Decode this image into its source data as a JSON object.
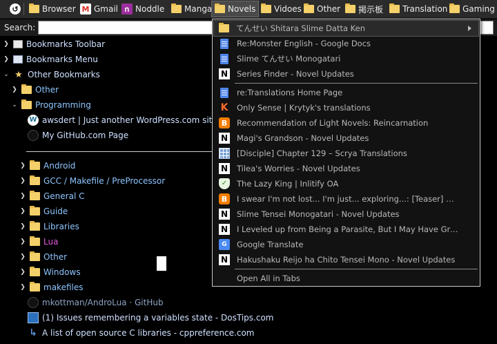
{
  "toolbar": {
    "items": [
      {
        "label": "",
        "icon": "back-icon"
      },
      {
        "label": "Browser",
        "icon": "folder-icon"
      },
      {
        "label": "Gmail",
        "icon": "gmail-icon"
      },
      {
        "label": "Noddle",
        "icon": "noddle-icon"
      },
      {
        "label": "Manga",
        "icon": "folder-icon"
      },
      {
        "label": "Novels",
        "icon": "folder-icon",
        "active": true
      },
      {
        "label": "Vidoes",
        "icon": "folder-icon"
      },
      {
        "label": "Other",
        "icon": "folder-icon"
      },
      {
        "label": "掲示板",
        "icon": "folder-icon"
      },
      {
        "label": "Translation",
        "icon": "folder-icon"
      },
      {
        "label": "Gaming",
        "icon": "folder-icon"
      }
    ]
  },
  "search": {
    "label": "Search:",
    "value": ""
  },
  "tree": {
    "roots": [
      {
        "label": "Bookmarks Toolbar",
        "expanded": false
      },
      {
        "label": "Bookmarks Menu",
        "expanded": false
      },
      {
        "label": "Other Bookmarks",
        "expanded": true
      }
    ],
    "other_folder": "Other",
    "programming_folder": "Programming",
    "programming_links": [
      "awsdert | Just another WordPress.com site",
      "My GitHub.com Page"
    ],
    "subfolders": [
      "Android",
      "GCC / Makefile / PreProcessor",
      "General C",
      "Guide",
      "Libraries",
      "Lua",
      "Other",
      "Windows",
      "makefiles"
    ],
    "bottom_links": [
      "mkottman/AndroLua · GitHub",
      "(1) Issues remembering a variables state - DosTips.com",
      "A list of open source C libraries - cppreference.com"
    ]
  },
  "menu": {
    "items": [
      {
        "label": "てんせい Shitara Slime Datta Ken",
        "icon": "folder-icon",
        "submenu": true
      },
      {
        "label": "Re:Monster English - Google Docs",
        "icon": "google-docs-icon"
      },
      {
        "label": "Slime てんせい Monogatari",
        "icon": "google-docs-icon"
      },
      {
        "label": "Series Finder - Novel Updates",
        "icon": "novel-updates-icon"
      },
      {
        "label": "re:Translations Home Page",
        "icon": "google-docs-icon"
      },
      {
        "label": "Only Sense | Krytyk's translations",
        "icon": "krytyk-icon"
      },
      {
        "label": "Recommendation of Light Novels: Reincarnation",
        "icon": "blogger-icon"
      },
      {
        "label": "Magi's Grandson - Novel Updates",
        "icon": "novel-updates-icon"
      },
      {
        "label": "[Disciple] Chapter 129 – Scrya Translations",
        "icon": "grid-icon"
      },
      {
        "label": "Tilea's Worries - Novel Updates",
        "icon": "novel-updates-icon"
      },
      {
        "label": "The Lazy King | Inlitify OA",
        "icon": "shield-icon"
      },
      {
        "label": "I swear I'm not lost... I'm just... exploring...: [Teaser] 私、能力...",
        "icon": "blogger-icon"
      },
      {
        "label": "Slime Tensei Monogatari - Novel Updates",
        "icon": "novel-updates-icon"
      },
      {
        "label": "I Leveled up from Being a Parasite, But I May Have Grown T...",
        "icon": "novel-updates-icon"
      },
      {
        "label": "Google Translate",
        "icon": "google-translate-icon"
      },
      {
        "label": "Hakushaku Reijo ha Chito Tensei Mono - Novel Updates",
        "icon": "novel-updates-icon"
      }
    ],
    "open_all": "Open All in Tabs"
  },
  "colors": {
    "folder": "#f4d06a",
    "link": "#cfe0ff",
    "folder_text": "#8ec5ff",
    "lua": "#e05adc",
    "menu_bg": "#121212"
  }
}
